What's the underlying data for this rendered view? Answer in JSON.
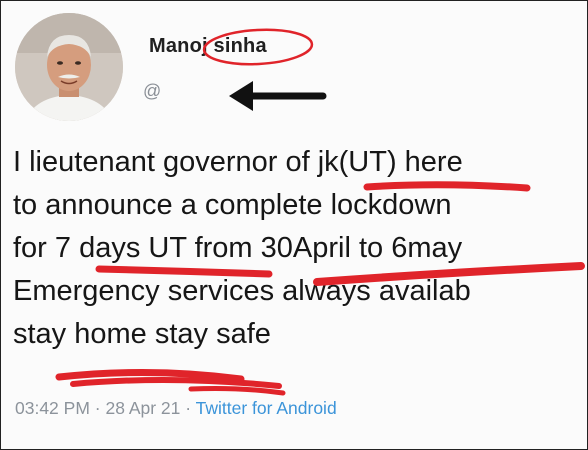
{
  "tweet": {
    "author_name": "Manoj sinha",
    "handle": "@",
    "lines": [
      "I lieutenant governor of jk(UT) here",
      "to announce a complete lockdown",
      "for 7 days UT from 30April to 6may",
      "Emergency services always availab",
      "stay home stay safe"
    ],
    "time": "03:42 PM",
    "date": "28 Apr 21",
    "source": "Twitter for Android",
    "separator": " · "
  },
  "colors": {
    "annotation_red": "#e0242a",
    "arrow": "#111111",
    "meta_grey": "#8c939b",
    "source_blue": "#3b94d9"
  },
  "icons": {
    "avatar": "profile-photo",
    "arrow": "left-arrow"
  }
}
